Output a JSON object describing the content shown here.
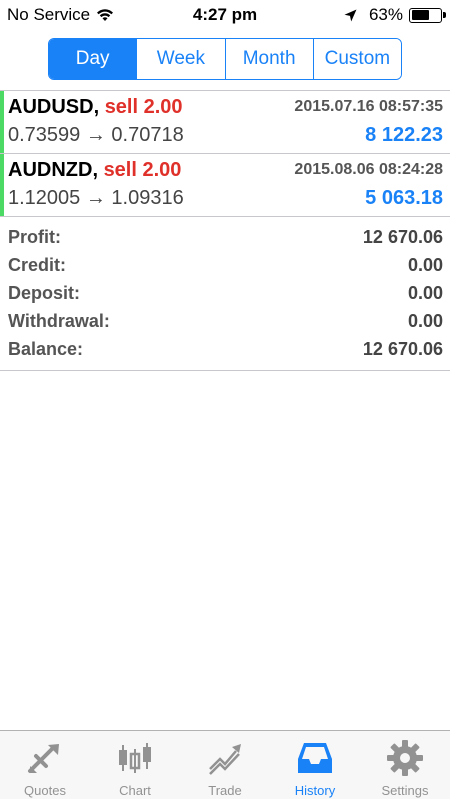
{
  "status_bar": {
    "carrier": "No Service",
    "time": "4:27 pm",
    "battery": "63%",
    "battery_level": 0.63
  },
  "segments": [
    {
      "label": "Day",
      "active": true
    },
    {
      "label": "Week",
      "active": false
    },
    {
      "label": "Month",
      "active": false
    },
    {
      "label": "Custom",
      "active": false
    }
  ],
  "deals": [
    {
      "symbol": "AUDUSD",
      "action": "sell 2.00",
      "datetime": "2015.07.16 08:57:35",
      "prices": "0.73599 → 0.70718",
      "profit": "8 122.23"
    },
    {
      "symbol": "AUDNZD",
      "action": "sell 2.00",
      "datetime": "2015.08.06 08:24:28",
      "prices": "1.12005 → 1.09316",
      "profit": "5 063.18"
    }
  ],
  "summary": [
    {
      "label": "Profit:",
      "value": "12 670.06"
    },
    {
      "label": "Credit:",
      "value": "0.00"
    },
    {
      "label": "Deposit:",
      "value": "0.00"
    },
    {
      "label": "Withdrawal:",
      "value": "0.00"
    },
    {
      "label": "Balance:",
      "value": "12 670.06"
    }
  ],
  "tabs": [
    {
      "label": "Quotes",
      "icon": "quotes-icon",
      "active": false
    },
    {
      "label": "Chart",
      "icon": "chart-icon",
      "active": false
    },
    {
      "label": "Trade",
      "icon": "trade-icon",
      "active": false
    },
    {
      "label": "History",
      "icon": "history-icon",
      "active": true
    },
    {
      "label": "Settings",
      "icon": "gear-icon",
      "active": false
    }
  ],
  "colors": {
    "accent": "#1a82f7",
    "sell": "#e0302a",
    "deal_bar": "#4cd964"
  }
}
